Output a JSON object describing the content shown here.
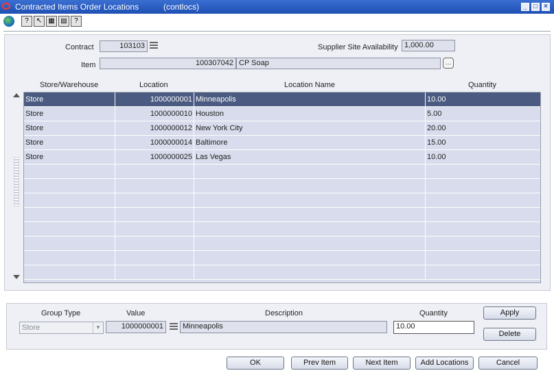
{
  "window": {
    "title": "Contracted Items Order Locations",
    "code": "(contlocs)"
  },
  "toolbar": {
    "icons": [
      "globe-icon",
      "help-icon",
      "pointer-help-icon",
      "calendar-icon",
      "notes-icon",
      "question-icon"
    ],
    "b1": "?",
    "b2": "↖",
    "b3": "▦",
    "b4": "▤",
    "b5": "?"
  },
  "header": {
    "contract_label": "Contract",
    "contract_value": "103103",
    "item_label": "Item",
    "item_value": "100307042",
    "item_desc": "CP Soap",
    "supplier_label": "Supplier Site Availability",
    "supplier_value": "1,000.00"
  },
  "table": {
    "columns": [
      "Store/Warehouse",
      "Location",
      "Location Name",
      "Quantity"
    ],
    "rows": [
      {
        "type": "Store",
        "location": "1000000001",
        "name": "Minneapolis",
        "qty": "10.00"
      },
      {
        "type": "Store",
        "location": "1000000010",
        "name": "Houston",
        "qty": "5.00"
      },
      {
        "type": "Store",
        "location": "1000000012",
        "name": "New York City",
        "qty": "20.00"
      },
      {
        "type": "Store",
        "location": "1000000014",
        "name": "Baltimore",
        "qty": "15.00"
      },
      {
        "type": "Store",
        "location": "1000000025",
        "name": "Las Vegas",
        "qty": "10.00"
      }
    ]
  },
  "entry": {
    "group_type_label": "Group Type",
    "value_label": "Value",
    "description_label": "Description",
    "quantity_label": "Quantity",
    "group_type": "Store",
    "value": "1000000001",
    "description": "Minneapolis",
    "quantity": "10.00",
    "apply": "Apply",
    "delete": "Delete"
  },
  "buttons": {
    "ok": "OK",
    "prev": "Prev Item",
    "next": "Next Item",
    "add": "Add Locations",
    "cancel": "Cancel"
  }
}
